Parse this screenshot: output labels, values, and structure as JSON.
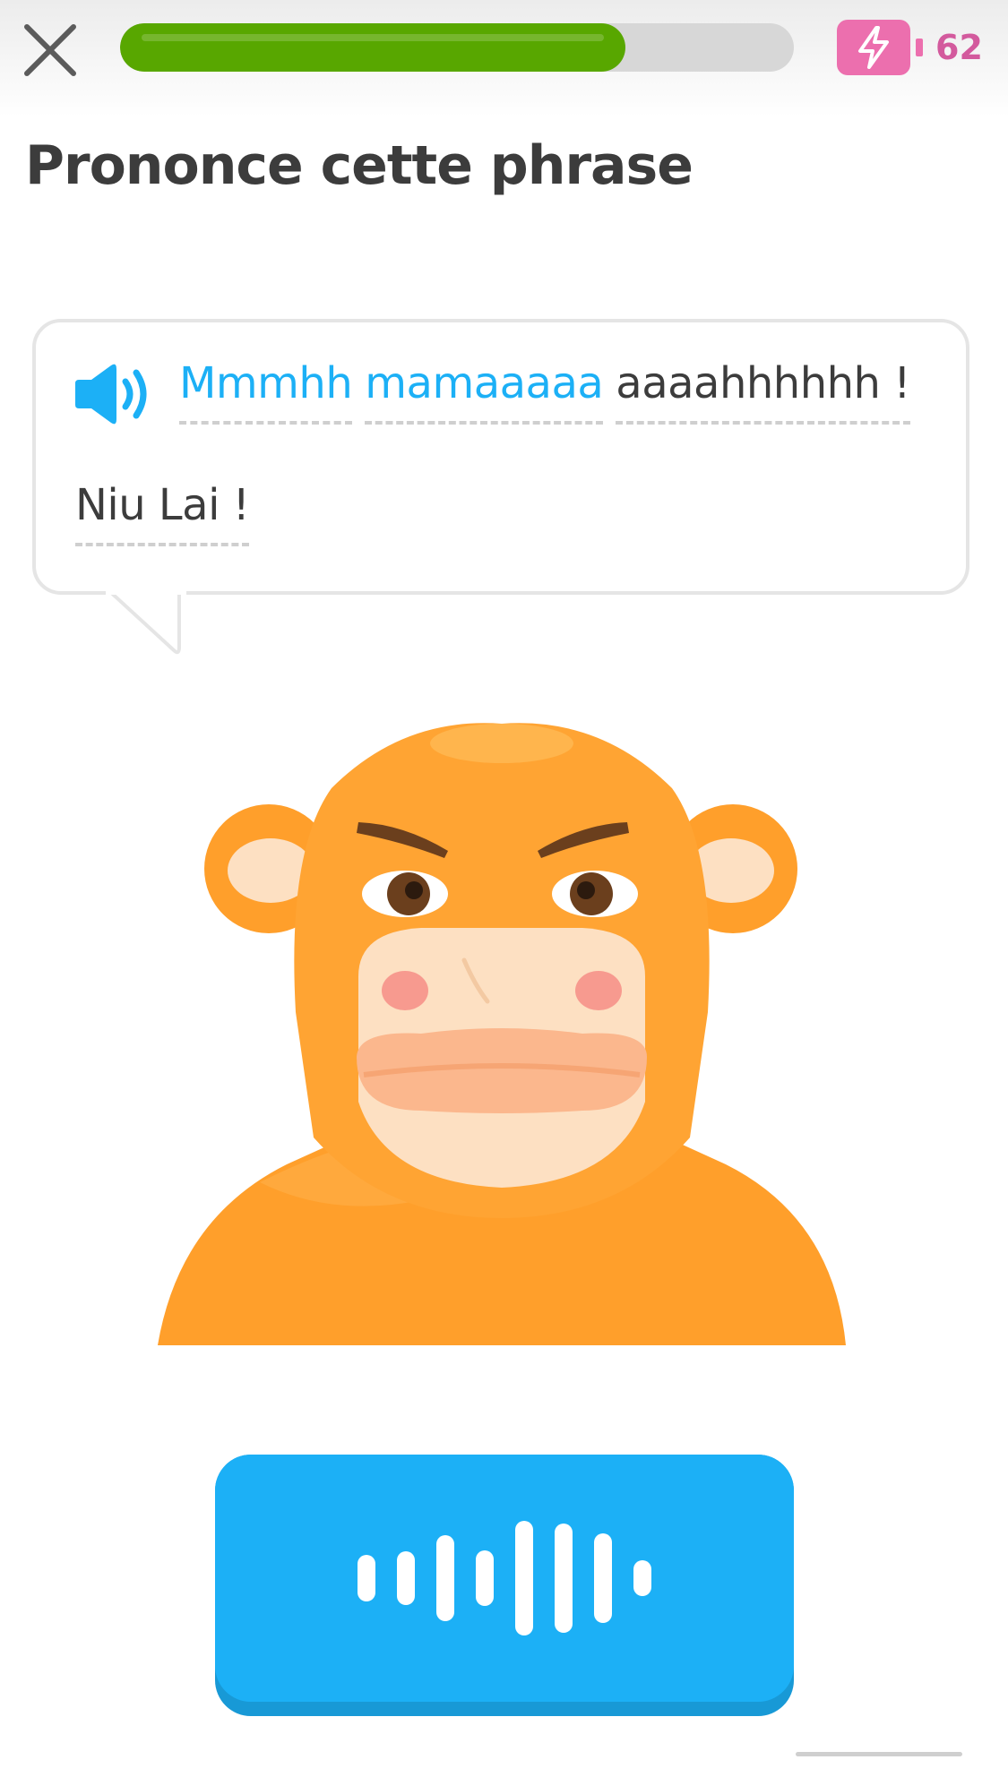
{
  "header": {
    "close_icon": "close-icon",
    "progress_fraction": 0.75,
    "progress_color": "#58a700",
    "energy_icon": "lightning-battery-icon",
    "energy_color": "#ec6fae",
    "energy_count": "62"
  },
  "page_title": "Prononce cette phrase",
  "prompt": {
    "speaker_icon": "speaker-icon",
    "lines": [
      [
        {
          "text": "Mmmhh",
          "style": "spoken"
        },
        {
          "text": "mamaaaaa",
          "style": "spoken"
        },
        {
          "text": "aaaahhhhhh !",
          "style": "plain"
        }
      ],
      [
        {
          "text": "Niu Lai !",
          "style": "plain"
        }
      ]
    ]
  },
  "character": {
    "name_icon": "monkey-character"
  },
  "record_button": {
    "icon": "voice-waveform-icon",
    "color": "#1cb0f6",
    "shadow_color": "#1899d6"
  }
}
